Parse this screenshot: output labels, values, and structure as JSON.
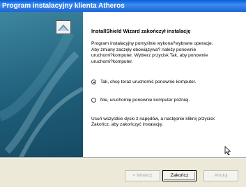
{
  "window": {
    "title": "Program instalacyjny klienta Atheros"
  },
  "wizard": {
    "heading": "InstallShield Wizard zakończył instalację",
    "message": "Program instalacyjny pomyślnie wykona?wybrane operacje.\nAby zmiany zaczęły obowiązywa? należy ponownie\nuruchomi?komputer.  Wybierz przycisk Tak, aby ponownie\nuruchomi?komputer.",
    "options": [
      {
        "label": "Tak, chcę teraz uruchomić ponownie komputer.",
        "selected": true
      },
      {
        "label": "Nie, uruchomię ponownie komputer później.",
        "selected": false
      }
    ],
    "footer": "Usuń wszystkie dyski z napędów, a następnie kliknij przycisk\nZakończ, aby zakończyć instalację."
  },
  "buttons": {
    "back": "< Wstecz",
    "finish": "Zakończ",
    "cancel": "Anuluj"
  }
}
